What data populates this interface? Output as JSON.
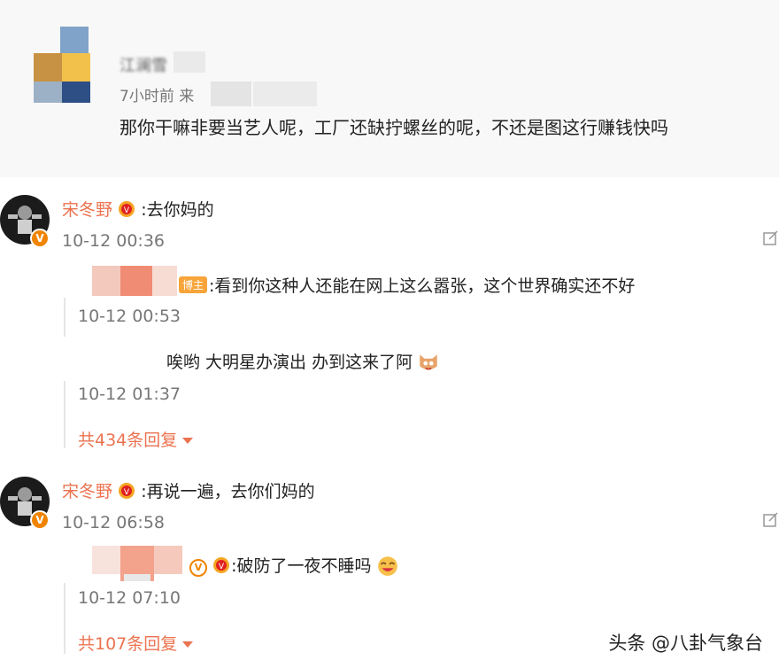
{
  "post": {
    "username": "江澜雪",
    "meta": "7小时前 来",
    "text": "那你干嘛非要当艺人呢，工厂还缺拧螺丝的呢，不还是图这行赚钱快吗"
  },
  "comments": [
    {
      "author": "宋冬野",
      "text": ":去你妈的",
      "time": "10-12 00:36",
      "replies": [
        {
          "tag": "博主",
          "text": ":看到你这种人还能在网上这么嚣张，这个世界确实还不好",
          "time": "10-12 00:53"
        },
        {
          "text": "唉哟 大明星办演出 办到这来了阿",
          "time": "10-12 01:37"
        }
      ],
      "more": "共434条回复"
    },
    {
      "author": "宋冬野",
      "text": ":再说一遍，去你们妈的",
      "time": "10-12 06:58",
      "replies": [
        {
          "text": ":破防了一夜不睡吗",
          "time": "10-12 07:10"
        }
      ],
      "more": "共107条回复"
    }
  ],
  "watermark": "头条 @八卦气象台",
  "colors": {
    "accent": "#eb7350",
    "meta": "#777777",
    "badge": "#f08400"
  },
  "icons": [
    "crown-badge-icon",
    "verified-v-icon",
    "edit-icon",
    "emoji-cat-icon",
    "emoji-laugh-icon",
    "chevron-down-icon"
  ]
}
